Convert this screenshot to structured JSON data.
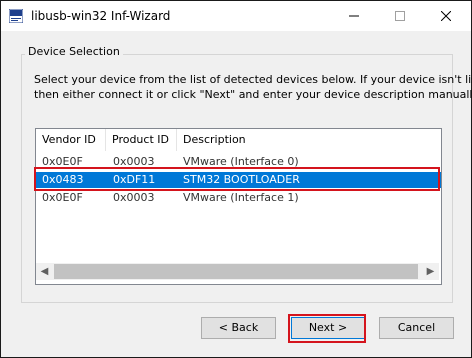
{
  "window": {
    "title": "libusb-win32 Inf-Wizard",
    "app_icon": "inf-wizard-icon",
    "controls": {
      "minimize": "—",
      "maximize": "☐",
      "close": "✕"
    }
  },
  "group": {
    "label": "Device Selection",
    "description_line1": "Select your device from the list of detected devices below. If your device isn't listed",
    "description_line2": "then either connect it or click \"Next\" and enter your device description manually."
  },
  "device_list": {
    "columns": [
      "Vendor ID",
      "Product ID",
      "Description"
    ],
    "rows": [
      {
        "vendor_id": "0x0E0F",
        "product_id": "0x0003",
        "description": "VMware (Interface 0)",
        "selected": false
      },
      {
        "vendor_id": "0x0483",
        "product_id": "0xDF11",
        "description": "STM32  BOOTLOADER",
        "selected": true
      },
      {
        "vendor_id": "0x0E0F",
        "product_id": "0x0003",
        "description": "VMware (Interface 1)",
        "selected": false
      }
    ],
    "scroll_left": "◀",
    "scroll_right": "▶"
  },
  "buttons": {
    "back": "< Back",
    "next": "Next >",
    "cancel": "Cancel"
  },
  "colors": {
    "selection": "#0078d7",
    "highlight_outline": "#d4141d"
  }
}
